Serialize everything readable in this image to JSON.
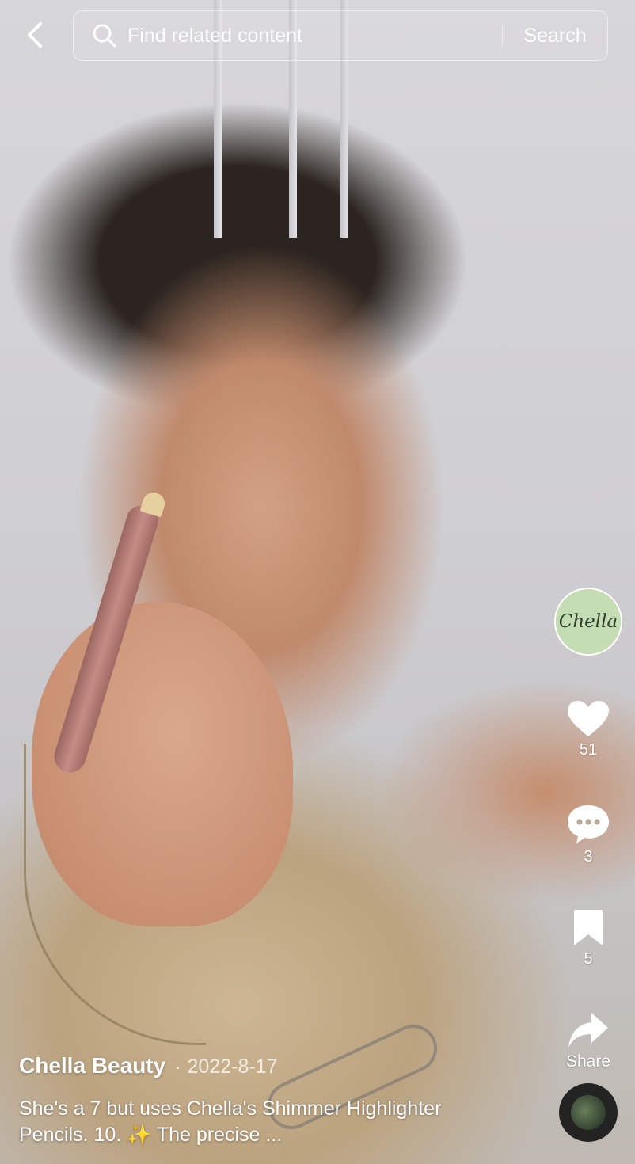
{
  "search": {
    "placeholder": "Find related content",
    "button_label": "Search"
  },
  "creator": {
    "avatar_text": "Chella"
  },
  "actions": {
    "likes": "51",
    "comments": "3",
    "saves": "5",
    "share_label": "Share"
  },
  "post": {
    "author": "Chella Beauty",
    "separator": "·",
    "date": "2022-8-17",
    "description": "She's a 7 but uses Chella's Shimmer Highlighter Pencils. 10. ✨ The precise ..."
  },
  "icons": {
    "back": "chevron-left-icon",
    "search": "search-icon",
    "like": "heart-icon",
    "comment": "comment-bubble-icon",
    "save": "bookmark-icon",
    "share": "share-arrow-icon"
  },
  "colors": {
    "avatar_bg": "#c5ddb2",
    "text": "#ffffff"
  }
}
